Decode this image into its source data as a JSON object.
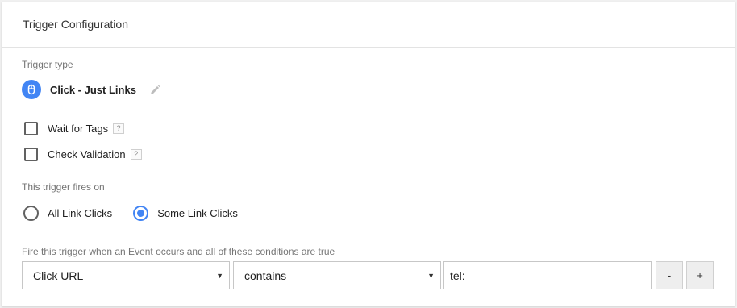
{
  "header": {
    "title": "Trigger Configuration"
  },
  "trigger_type": {
    "label": "Trigger type",
    "name": "Click - Just Links",
    "icon": "mouse-icon",
    "edit_icon": "pencil-icon"
  },
  "options": [
    {
      "label": "Wait for Tags",
      "checked": false,
      "help": "?"
    },
    {
      "label": "Check Validation",
      "checked": false,
      "help": "?"
    }
  ],
  "fires_on": {
    "label": "This trigger fires on",
    "choices": [
      {
        "label": "All Link Clicks",
        "selected": false
      },
      {
        "label": "Some Link Clicks",
        "selected": true
      }
    ]
  },
  "condition": {
    "label": "Fire this trigger when an Event occurs and all of these conditions are true",
    "variable": "Click URL",
    "operator": "contains",
    "value": "tel:",
    "remove_label": "-",
    "add_label": "+"
  },
  "colors": {
    "accent": "#4285f4",
    "border": "#c7c7c7",
    "muted_text": "#757575"
  }
}
